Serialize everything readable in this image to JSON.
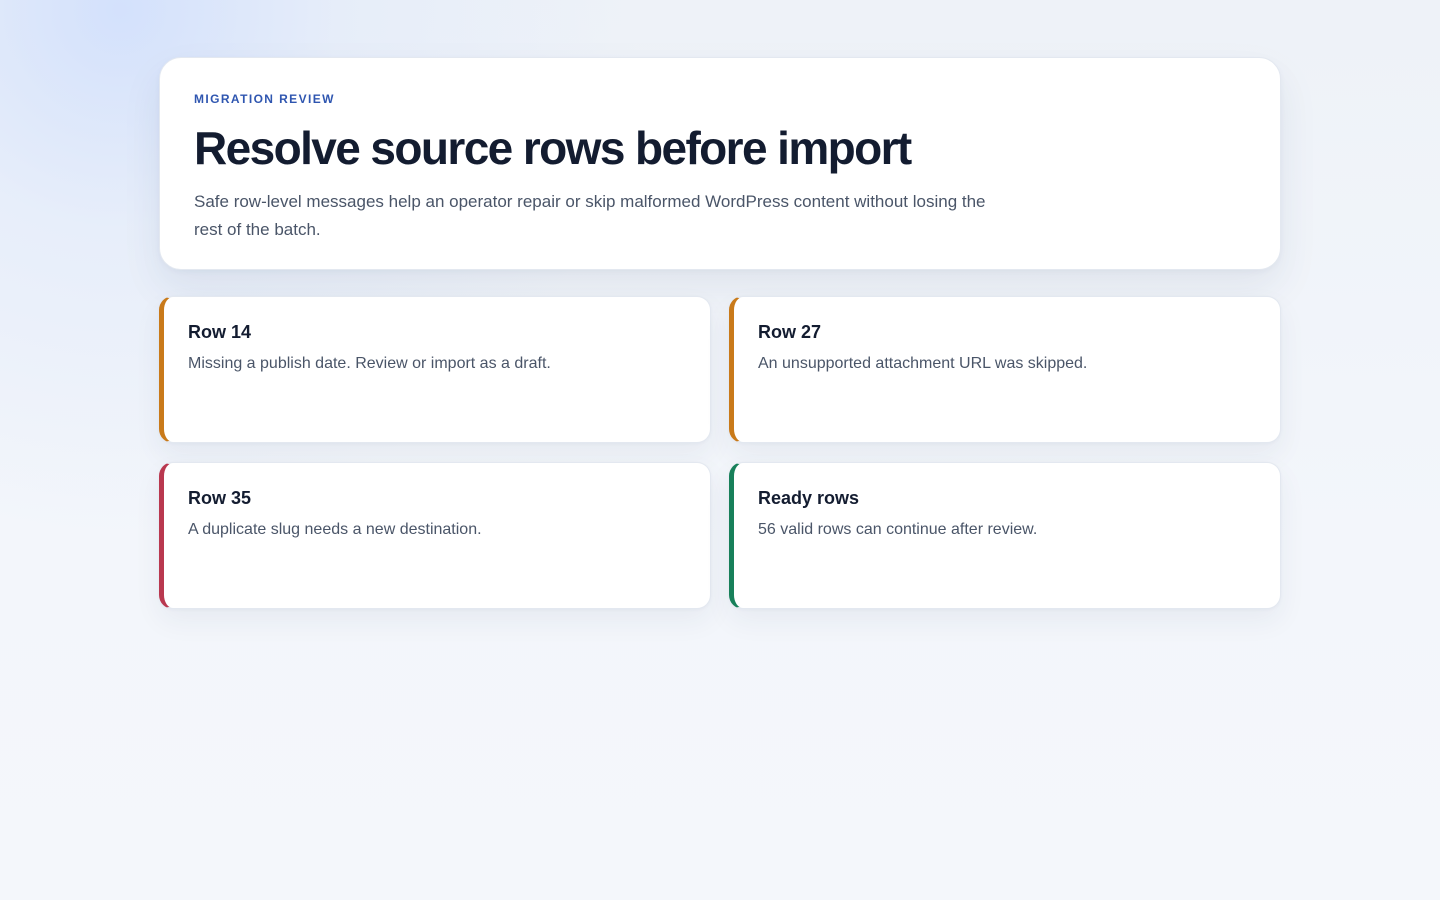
{
  "header": {
    "eyebrow": "MIGRATION REVIEW",
    "title": "Resolve source rows before import",
    "subtitle": "Safe row-level messages help an operator repair or skip malformed WordPress content without losing the rest of the batch."
  },
  "cards": [
    {
      "title": "Row 14",
      "message": "Missing a publish date. Review or import as a draft.",
      "status": "warning",
      "accent": "#c97a1a"
    },
    {
      "title": "Row 27",
      "message": "An unsupported attachment URL was skipped.",
      "status": "warning",
      "accent": "#c97a1a"
    },
    {
      "title": "Row 35",
      "message": "A duplicate slug needs a new destination.",
      "status": "error",
      "accent": "#b9384f"
    },
    {
      "title": "Ready rows",
      "message": "56 valid rows can continue after review.",
      "status": "success",
      "accent": "#18805a"
    }
  ],
  "colors": {
    "eyebrow": "#2f56b0",
    "heading": "#131c30",
    "body": "#4a5568",
    "background": "#f3f6fb"
  }
}
